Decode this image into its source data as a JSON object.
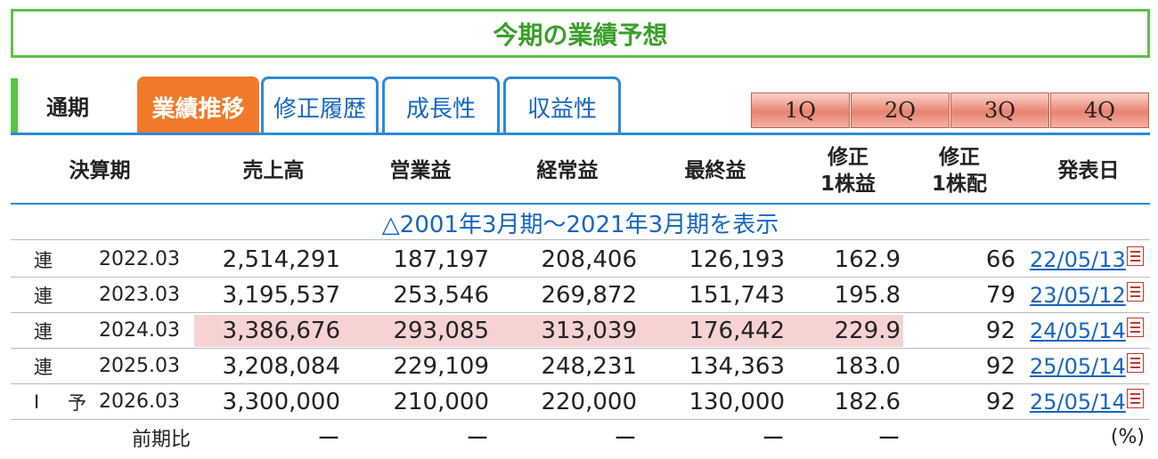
{
  "title": "今期の業績予想",
  "tabs": {
    "period_label": "通期",
    "items": [
      "業績推移",
      "修正履歴",
      "成長性",
      "収益性"
    ],
    "quarter_buttons": [
      "1Q",
      "2Q",
      "3Q",
      "4Q"
    ]
  },
  "table": {
    "headers": {
      "period": "決算期",
      "sales": "売上高",
      "operating": "営業益",
      "ordinary": "経常益",
      "net": "最終益",
      "eps_line1": "修正",
      "eps_line2": "1株益",
      "dps_line1": "修正",
      "dps_line2": "1株配",
      "date": "発表日"
    },
    "range_link": "△2001年3月期～2021年3月期を表示",
    "rows": [
      {
        "type": "連",
        "flag": "",
        "period": "2022.03",
        "sales": "2,514,291",
        "operating": "187,197",
        "ordinary": "208,406",
        "net": "126,193",
        "eps": "162.9",
        "dps": "66",
        "date": "22/05/13"
      },
      {
        "type": "連",
        "flag": "",
        "period": "2023.03",
        "sales": "3,195,537",
        "operating": "253,546",
        "ordinary": "269,872",
        "net": "151,743",
        "eps": "195.8",
        "dps": "79",
        "date": "23/05/12"
      },
      {
        "type": "連",
        "flag": "",
        "period": "2024.03",
        "sales": "3,386,676",
        "operating": "293,085",
        "ordinary": "313,039",
        "net": "176,442",
        "eps": "229.9",
        "dps": "92",
        "date": "24/05/14"
      },
      {
        "type": "連",
        "flag": "",
        "period": "2025.03",
        "sales": "3,208,084",
        "operating": "229,109",
        "ordinary": "248,231",
        "net": "134,363",
        "eps": "183.0",
        "dps": "92",
        "date": "25/05/14"
      },
      {
        "type": "I",
        "flag": "予",
        "period": "2026.03",
        "sales": "3,300,000",
        "operating": "210,000",
        "ordinary": "220,000",
        "net": "130,000",
        "eps": "182.6",
        "dps": "92",
        "date": "25/05/14"
      }
    ],
    "yoy": {
      "label": "前期比",
      "sales": "ー",
      "operating": "ー",
      "ordinary": "ー",
      "net": "ー",
      "eps": "ー",
      "unit": "(%)"
    }
  },
  "colors": {
    "title_green": "#3aa02a",
    "border_green": "#5cc244",
    "tab_blue": "#2e8ad8",
    "active_tab_orange": "#f07a2a",
    "highlight_pink": "#f6d2d2"
  }
}
